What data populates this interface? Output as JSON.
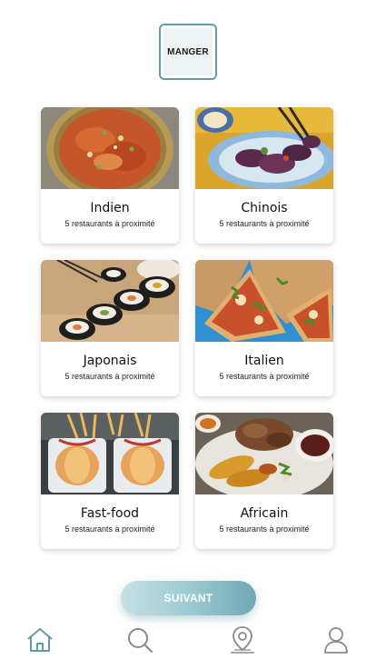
{
  "logo": {
    "text": "MANGER"
  },
  "categories": [
    {
      "name": "Indien",
      "subtitle": "5 restaurants à proximité",
      "image": "indian-food-photo"
    },
    {
      "name": "Chinois",
      "subtitle": "5 restaurants à proximité",
      "image": "chinese-food-photo"
    },
    {
      "name": "Japonais",
      "subtitle": "5 restaurants à proximité",
      "image": "japanese-sushi-photo"
    },
    {
      "name": "Italien",
      "subtitle": "5 restaurants à proximité",
      "image": "italian-pizza-photo"
    },
    {
      "name": "Fast-food",
      "subtitle": "5 restaurants à proximité",
      "image": "fastfood-hotdog-photo"
    },
    {
      "name": "Africain",
      "subtitle": "5 restaurants à proximité",
      "image": "african-food-photo"
    }
  ],
  "next_button": {
    "label": "SUIVANT"
  },
  "nav": {
    "items": [
      {
        "icon": "home-icon",
        "active": true
      },
      {
        "icon": "search-icon",
        "active": false
      },
      {
        "icon": "map-pin-icon",
        "active": false
      },
      {
        "icon": "user-icon",
        "active": false
      }
    ]
  },
  "colors": {
    "accent": "#5f9ea8",
    "inactive_icon": "#8a8a8a"
  }
}
